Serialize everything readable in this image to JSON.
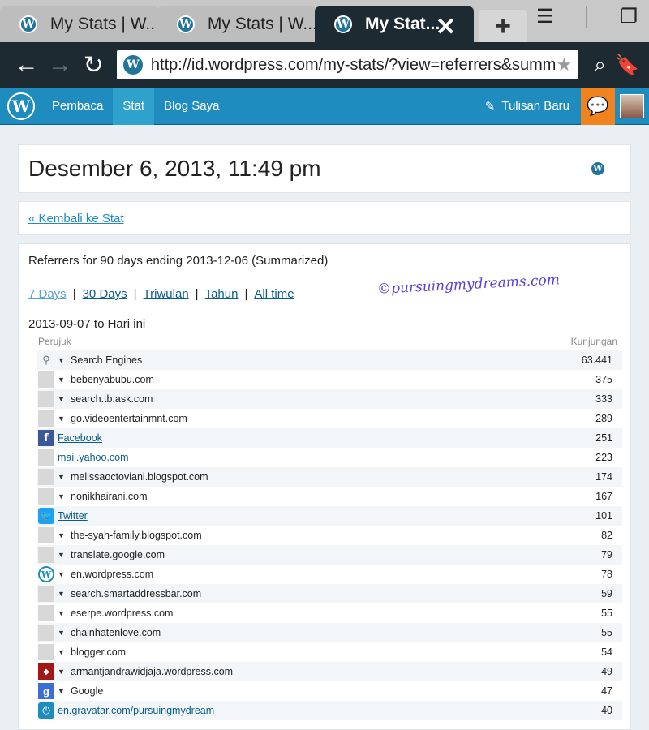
{
  "browser": {
    "tabs": [
      {
        "title": "My Stats | W...",
        "active": false
      },
      {
        "title": "My Stats | W...",
        "active": false
      },
      {
        "title": "My Stat...",
        "active": true
      }
    ],
    "url": "http://id.wordpress.com/my-stats/?view=referrers&summ"
  },
  "adminbar": {
    "logo": "W",
    "nav": [
      "Pembaca",
      "Stat",
      "Blog Saya"
    ],
    "active_nav": "Stat",
    "new_post": "Tulisan Baru"
  },
  "date_title": "Desember 6, 2013, 11:49 pm",
  "back_link": "« Kembali ke Stat",
  "stats": {
    "subtitle": "Referrers for 90 days ending 2013-12-06 (Summarized)",
    "periods": [
      "7 Days",
      "30 Days",
      "Triwulan",
      "Tahun",
      "All time"
    ],
    "current_period": "7 Days",
    "watermark": "©pursuingmydreams.com",
    "range": "2013-09-07 to Hari ini",
    "col_referrer": "Perujuk",
    "col_visits": "Kunjungan",
    "rows": [
      {
        "icon": "search",
        "expand": true,
        "link": false,
        "name": "Search Engines",
        "count": "63.441"
      },
      {
        "icon": "blank",
        "expand": true,
        "link": false,
        "name": "bebenyabubu.com",
        "count": "375"
      },
      {
        "icon": "blank",
        "expand": true,
        "link": false,
        "name": "search.tb.ask.com",
        "count": "333"
      },
      {
        "icon": "blank",
        "expand": true,
        "link": false,
        "name": "go.videoentertainmnt.com",
        "count": "289"
      },
      {
        "icon": "facebook",
        "expand": false,
        "link": true,
        "name": "Facebook",
        "count": "251"
      },
      {
        "icon": "blank",
        "expand": false,
        "link": true,
        "name": "mail.yahoo.com",
        "count": "223"
      },
      {
        "icon": "blank",
        "expand": true,
        "link": false,
        "name": "melissaoctoviani.blogspot.com",
        "count": "174"
      },
      {
        "icon": "blank",
        "expand": true,
        "link": false,
        "name": "nonikhairani.com",
        "count": "167"
      },
      {
        "icon": "twitter",
        "expand": false,
        "link": true,
        "name": "Twitter",
        "count": "101"
      },
      {
        "icon": "blank",
        "expand": true,
        "link": false,
        "name": "the-syah-family.blogspot.com",
        "count": "82"
      },
      {
        "icon": "blank",
        "expand": true,
        "link": false,
        "name": "translate.google.com",
        "count": "79"
      },
      {
        "icon": "wordpress",
        "expand": true,
        "link": false,
        "name": "en.wordpress.com",
        "count": "78"
      },
      {
        "icon": "blank",
        "expand": true,
        "link": false,
        "name": "search.smartaddressbar.com",
        "count": "59"
      },
      {
        "icon": "blank",
        "expand": true,
        "link": false,
        "name": "eserpe.wordpress.com",
        "count": "55"
      },
      {
        "icon": "blank",
        "expand": true,
        "link": false,
        "name": "chainhatenlove.com",
        "count": "55"
      },
      {
        "icon": "blank",
        "expand": true,
        "link": false,
        "name": "blogger.com",
        "count": "54"
      },
      {
        "icon": "armant",
        "expand": true,
        "link": false,
        "name": "armantjandrawidjaja.wordpress.com",
        "count": "49"
      },
      {
        "icon": "google",
        "expand": true,
        "link": false,
        "name": "Google",
        "count": "47"
      },
      {
        "icon": "gravatar",
        "expand": false,
        "link": true,
        "name": "en.gravatar.com/pursuingmydream",
        "count": "40"
      }
    ]
  }
}
